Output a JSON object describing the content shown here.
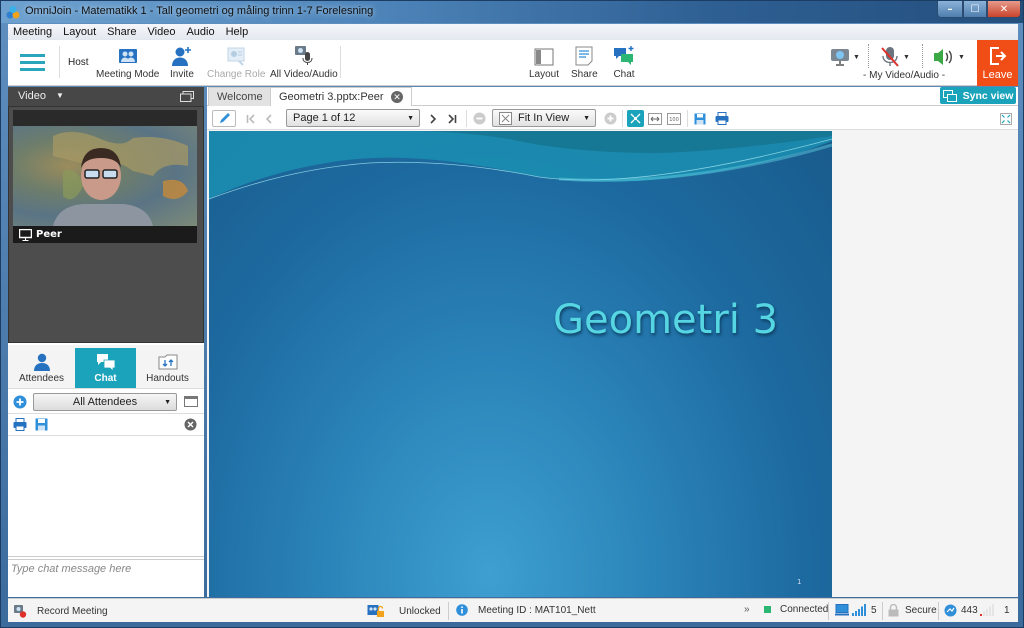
{
  "window": {
    "title": "OmniJoin - Matematikk 1 - Tall  geometri og måling  trinn 1-7  Forelesning",
    "controls": {
      "minimize": "–",
      "maximize": "☐",
      "close": "✕"
    }
  },
  "menu": [
    "Meeting",
    "Layout",
    "Share",
    "Video",
    "Audio",
    "Help"
  ],
  "toolbar": {
    "role": "Host",
    "meeting_mode": "Meeting Mode",
    "invite": "Invite",
    "change_role": "Change Role",
    "all_video_audio": "All Video/Audio",
    "layout": "Layout",
    "share": "Share",
    "chat": "Chat",
    "my_video_audio": "- My Video/Audio -",
    "leave": "Leave",
    "dropdown_glyph": "▼"
  },
  "video_panel": {
    "header": "Video",
    "header_arrow": "▼",
    "participant_name": "Peer"
  },
  "side_tabs": [
    {
      "label": "Attendees",
      "active": false
    },
    {
      "label": "Chat",
      "active": true
    },
    {
      "label": "Handouts",
      "active": false
    }
  ],
  "chat": {
    "recipient": "All Attendees",
    "input_placeholder": "Type chat message here",
    "messages": []
  },
  "doc_tabs": [
    {
      "label": "Welcome",
      "active": false
    },
    {
      "label": "Geometri 3.pptx:Peer",
      "active": true,
      "close": "✕"
    }
  ],
  "sync_view": "Sync view",
  "viewer": {
    "page": "Page 1 of 12",
    "zoom_mode": "Fit In View",
    "fit_width_label": "↔",
    "actual_size_label": "100"
  },
  "slide": {
    "title": "Geometri 3",
    "number": "1"
  },
  "status_bar": {
    "record": "Record Meeting",
    "lock_state": "Unlocked",
    "meeting_id": "Meeting ID : MAT101_Nett",
    "expand": "»",
    "connection": "Connected",
    "signal_count": "5",
    "security": "Secure",
    "port": "443",
    "count2": "1"
  },
  "colors": {
    "accent": "#1aa3bb",
    "leave": "#f04e16",
    "connected": "#2bb673",
    "slide_title": "#56d6e2"
  }
}
